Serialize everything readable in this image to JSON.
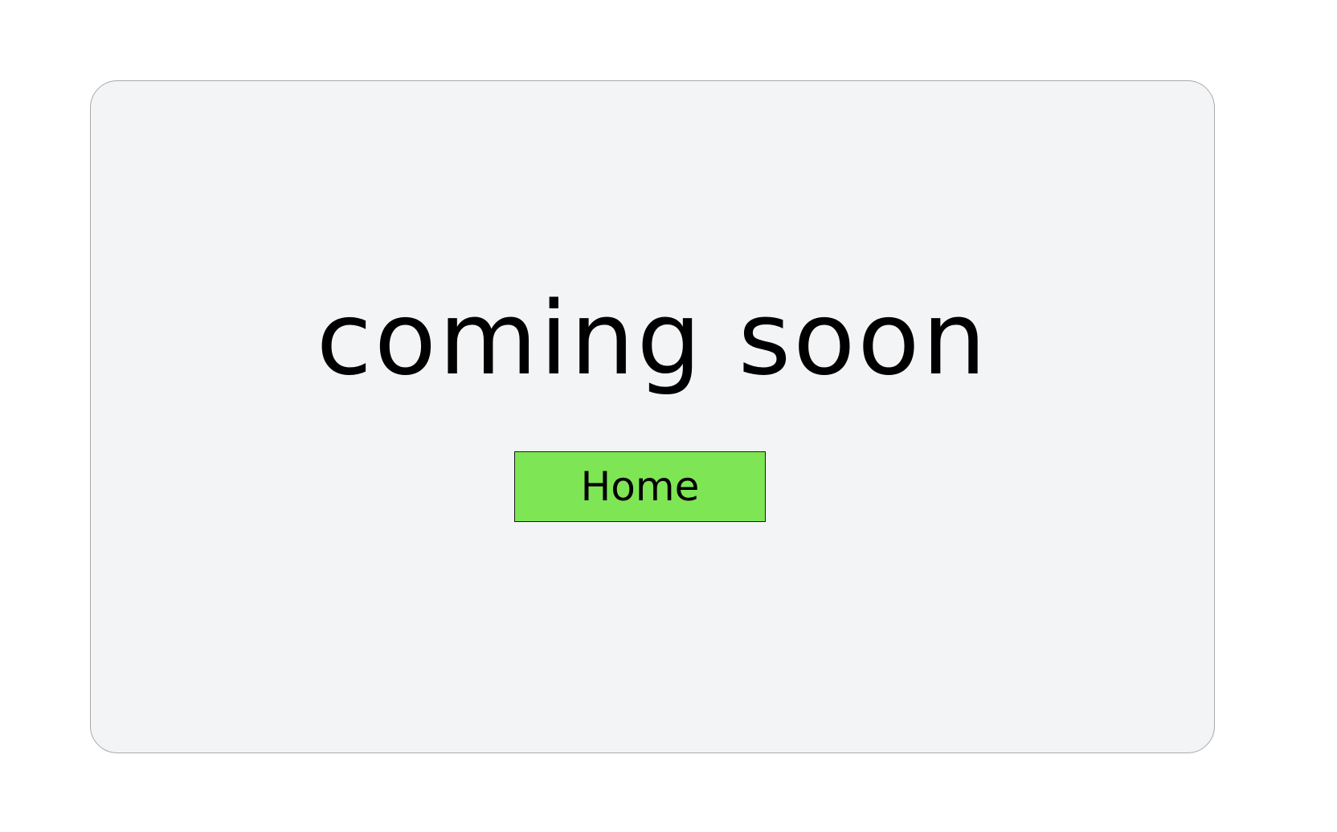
{
  "main": {
    "headline": "coming soon",
    "home_button_label": "Home"
  },
  "colors": {
    "page_background": "#ffffff",
    "card_background": "#f3f4f6",
    "card_border": "#a9a9a9",
    "button_background": "#7ee655",
    "text": "#000000"
  }
}
